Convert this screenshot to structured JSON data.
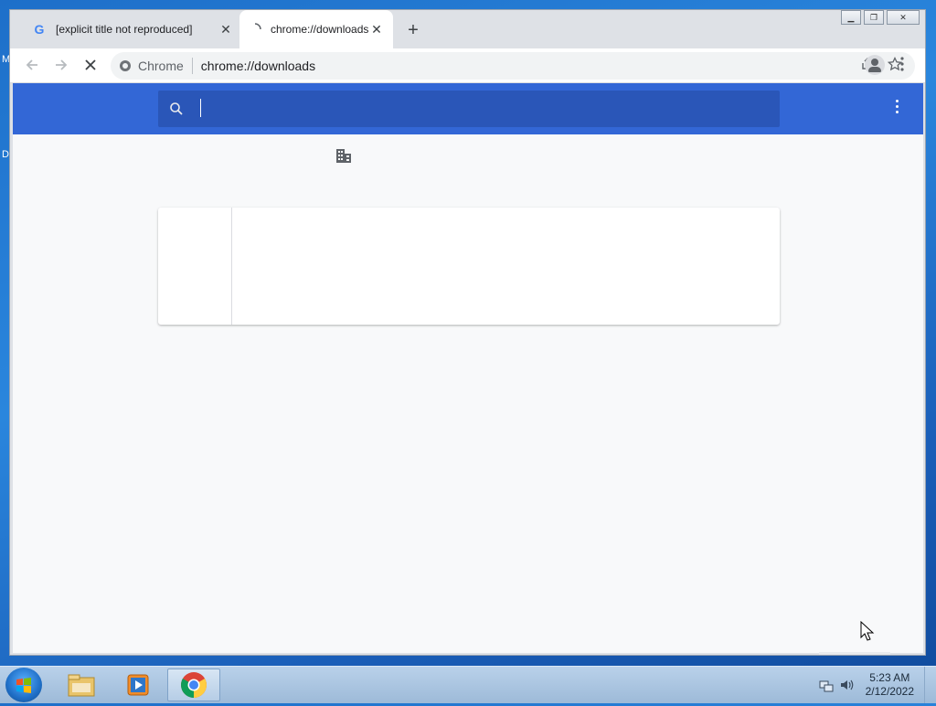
{
  "desktop": {
    "left_labels": [
      "M",
      "D"
    ]
  },
  "browser": {
    "tabs": [
      {
        "title": "[explicit title not reproduced]",
        "favicon": "google-g-icon",
        "close": "✕"
      },
      {
        "title": "chrome://downloads",
        "favicon": "loading-spinner-icon",
        "close": "✕"
      }
    ],
    "new_tab": "+",
    "omnibox": {
      "site_label": "Chrome",
      "url": "chrome://downloads"
    },
    "window_controls": [
      "minimize",
      "restore",
      "close"
    ]
  },
  "downloads_page": {
    "search_placeholder": "",
    "search_value": "",
    "header_color": "#3367d6"
  },
  "taskbar": {
    "clock_time": "5:23 AM",
    "clock_date": "2/12/2022",
    "pinned": [
      "file-explorer-icon",
      "media-player-icon",
      "chrome-icon"
    ]
  }
}
